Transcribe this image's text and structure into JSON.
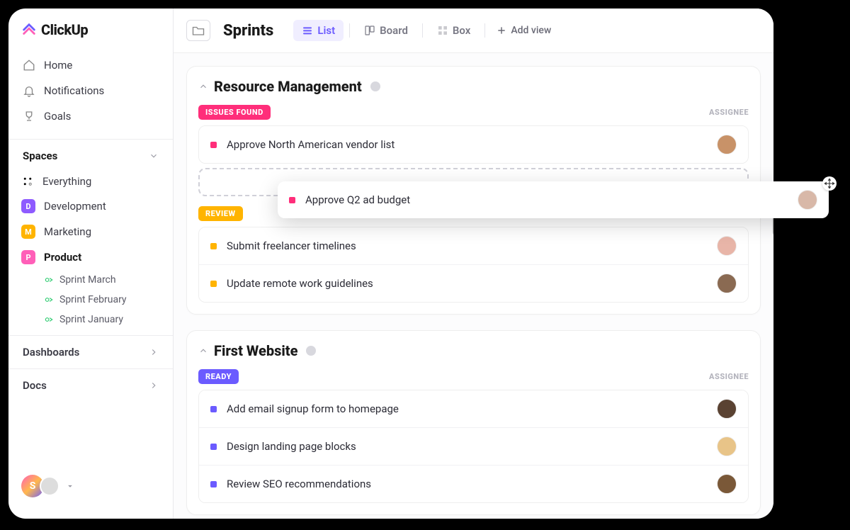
{
  "brand": "ClickUp",
  "nav": {
    "home": "Home",
    "notifications": "Notifications",
    "goals": "Goals"
  },
  "spaces": {
    "header": "Spaces",
    "everything": "Everything",
    "items": [
      {
        "initial": "D",
        "label": "Development",
        "color": "#8e5bff"
      },
      {
        "initial": "M",
        "label": "Marketing",
        "color": "#ffb400"
      },
      {
        "initial": "P",
        "label": "Product",
        "color": "#ff5fb8"
      }
    ]
  },
  "sprints": [
    "Sprint  March",
    "Sprint  February",
    "Sprint January"
  ],
  "bottom": {
    "dashboards": "Dashboards",
    "docs": "Docs"
  },
  "user_initial": "S",
  "header": {
    "title": "Sprints",
    "views": {
      "list": "List",
      "board": "Board",
      "box": "Box"
    },
    "add_view": "Add view"
  },
  "groups": [
    {
      "title": "Resource Management",
      "assignee_label": "ASSIGNEE",
      "statuses": [
        {
          "label": "ISSUES FOUND",
          "color": "#ff2e7a",
          "tasks": [
            {
              "title": "Approve North American vendor list",
              "dot": "#ff2e7a",
              "avatar": "#c89268"
            }
          ],
          "has_placeholder": true
        },
        {
          "label": "REVIEW",
          "color": "#ffb400",
          "tasks": [
            {
              "title": "Submit freelancer timelines",
              "dot": "#ffb400",
              "avatar": "#e8b5a8"
            },
            {
              "title": "Update remote work guidelines",
              "dot": "#ffb400",
              "avatar": "#8a6a52"
            }
          ]
        }
      ]
    },
    {
      "title": "First Website",
      "assignee_label": "ASSIGNEE",
      "statuses": [
        {
          "label": "READY",
          "color": "#6b5bff",
          "tasks": [
            {
              "title": "Add email signup form to homepage",
              "dot": "#6b5bff",
              "avatar": "#5a4232"
            },
            {
              "title": "Design landing page blocks",
              "dot": "#6b5bff",
              "avatar": "#e8c488"
            },
            {
              "title": "Review SEO recommendations",
              "dot": "#6b5bff",
              "avatar": "#7a5838"
            }
          ]
        }
      ]
    }
  ],
  "dragging": {
    "title": "Approve Q2 ad budget",
    "dot": "#ff2e7a",
    "avatar": "#d8b8a8"
  }
}
